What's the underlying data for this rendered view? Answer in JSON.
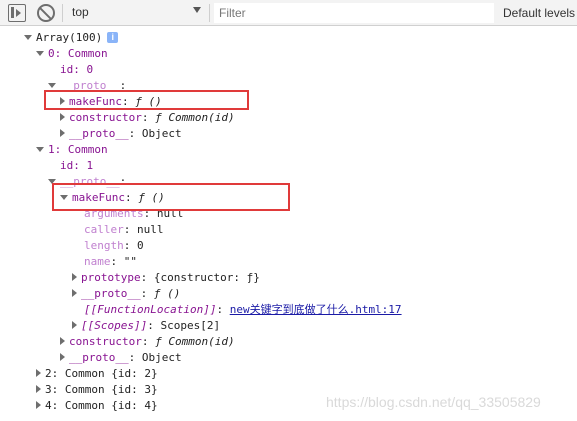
{
  "toolbar": {
    "context": "top",
    "filter_placeholder": "Filter",
    "levels_label": "Default levels"
  },
  "console": {
    "array_label": "Array(100)",
    "info_badge": "i",
    "item0_label": "0: Common",
    "item0_id": "id: 0",
    "item0_proto": "__proto__",
    "item0_makefunc_key": "makeFunc",
    "item0_makefunc_val": "ƒ ()",
    "item0_constructor_key": "constructor",
    "item0_constructor_val": "ƒ Common(id)",
    "item0_objproto_key": "__proto__",
    "item0_objproto_val": "Object",
    "item1_label": "1: Common",
    "item1_id": "id: 1",
    "item1_proto": "__proto__",
    "item1_makefunc_key": "makeFunc",
    "item1_makefunc_val": "ƒ ()",
    "arguments_key": "arguments",
    "arguments_val": "null",
    "caller_key": "caller",
    "caller_val": "null",
    "length_key": "length",
    "length_val": "0",
    "name_key": "name",
    "name_val": "\"\"",
    "prototype_key": "prototype",
    "prototype_val": "{constructor: ƒ}",
    "fn_proto_key": "__proto__",
    "fn_proto_val": "ƒ ()",
    "fnloc_key": "[[FunctionLocation]]",
    "fnloc_link": "new关键字到底做了什么.html:17",
    "scopes_key": "[[Scopes]]",
    "scopes_val": "Scopes[2]",
    "item1_constructor_key": "constructor",
    "item1_constructor_val": "ƒ Common(id)",
    "item1_objproto_key": "__proto__",
    "item1_objproto_val": "Object",
    "item2": "2: Common {id: 2}",
    "item3": "3: Common {id: 3}",
    "item4": "4: Common {id: 4}"
  },
  "watermark": "https://blog.csdn.net/qq_33505829"
}
